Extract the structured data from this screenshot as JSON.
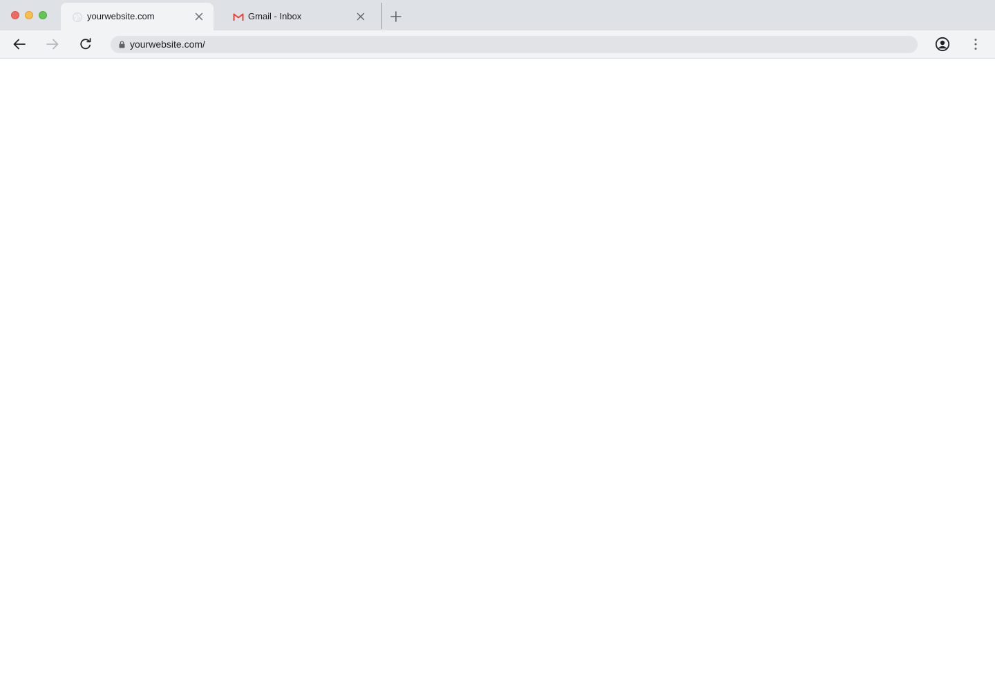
{
  "tabs": [
    {
      "title": "yourwebsite.com",
      "favicon": "globe-icon",
      "active": true
    },
    {
      "title": "Gmail - Inbox",
      "favicon": "gmail-icon",
      "active": false
    }
  ],
  "toolbar": {
    "url": "yourwebsite.com/",
    "secure": true
  },
  "colors": {
    "tabstrip_bg": "#dee1e6",
    "toolbar_bg": "#f1f3f4",
    "omnibox_bg": "#e1e3e6",
    "close_light": "#ed6a5e",
    "minimize_light": "#f5be4f",
    "maximize_light": "#62c554",
    "gmail_red": "#ea4335"
  }
}
